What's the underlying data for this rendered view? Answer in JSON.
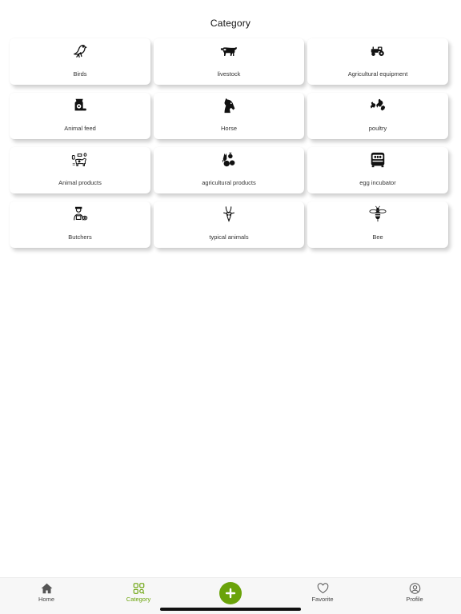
{
  "header": {
    "title": "Category"
  },
  "categories": [
    {
      "label": "Birds",
      "icon": "bird-icon"
    },
    {
      "label": "livestock",
      "icon": "cow-icon"
    },
    {
      "label": "Agricultural equipment",
      "icon": "tractor-icon"
    },
    {
      "label": "Animal feed",
      "icon": "feed-bag-icon"
    },
    {
      "label": "Horse",
      "icon": "horse-icon"
    },
    {
      "label": "poultry",
      "icon": "chickens-icon"
    },
    {
      "label": "Animal products",
      "icon": "dairy-icon"
    },
    {
      "label": "agricultural products",
      "icon": "produce-icon"
    },
    {
      "label": "egg incubator",
      "icon": "incubator-icon"
    },
    {
      "label": "Butchers",
      "icon": "butcher-icon"
    },
    {
      "label": "typical animals",
      "icon": "antelope-icon"
    },
    {
      "label": "Bee",
      "icon": "bee-icon"
    }
  ],
  "tabbar": {
    "home": "Home",
    "category": "Category",
    "favorite": "Favorite",
    "profile": "Profile"
  },
  "colors": {
    "accent": "#6aa30a"
  }
}
